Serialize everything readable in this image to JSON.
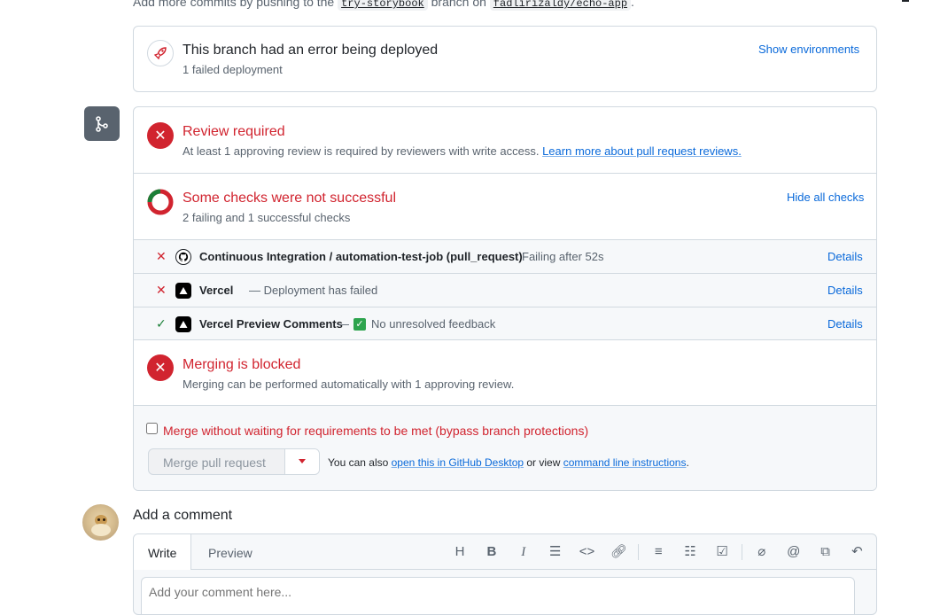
{
  "top_hint": {
    "prefix": "Add more commits by pushing to the ",
    "branch": "try-storybook",
    "middle": " branch on ",
    "repo": "fadlirizaldy/echo-app",
    "suffix": "."
  },
  "deploy": {
    "title": "This branch had an error being deployed",
    "subtitle": "1 failed deployment",
    "action": "Show environments"
  },
  "review": {
    "title": "Review required",
    "text": "At least 1 approving review is required by reviewers with write access.",
    "link": "Learn more about pull request reviews."
  },
  "checks": {
    "title": "Some checks were not successful",
    "subtitle": "2 failing and 1 successful checks",
    "action": "Hide all checks",
    "items": [
      {
        "status": "fail",
        "name": "Continuous Integration / automation-test-job (pull_request)",
        "desc": "Failing after 52s",
        "details": "Details"
      },
      {
        "status": "fail",
        "name": "Vercel",
        "desc": "— Deployment has failed",
        "details": "Details"
      },
      {
        "status": "pass",
        "name": "Vercel Preview Comments",
        "desc_prefix": "—",
        "desc": "No unresolved feedback",
        "details": "Details"
      }
    ]
  },
  "merge_block": {
    "title": "Merging is blocked",
    "subtitle": "Merging can be performed automatically with 1 approving review."
  },
  "bypass": {
    "label": "Merge without waiting for requirements to be met (bypass branch protections)"
  },
  "merge_actions": {
    "button": "Merge pull request",
    "also_prefix": "You can also ",
    "desktop_link": "open this in GitHub Desktop",
    "or_view": " or view ",
    "cli_link": "command line instructions",
    "suffix": "."
  },
  "comment": {
    "title": "Add a comment",
    "tabs": [
      "Write",
      "Preview"
    ],
    "placeholder": "Add your comment here..."
  },
  "colors": {
    "danger": "#d1242f",
    "success": "#1a7f37",
    "accent": "#0969da"
  },
  "toolbar_icons": [
    "heading-icon",
    "bold-icon",
    "italic-icon",
    "quote-icon",
    "code-icon",
    "link-icon",
    "ordered-list-icon",
    "unordered-list-icon",
    "task-list-icon",
    "attach-icon",
    "mention-icon",
    "reference-icon",
    "reply-icon",
    "slash-command-icon"
  ]
}
